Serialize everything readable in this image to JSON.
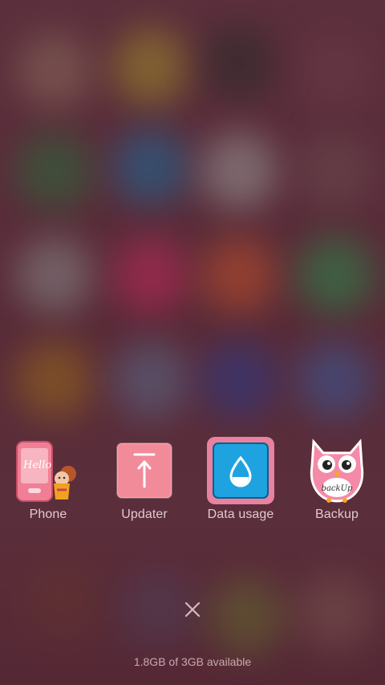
{
  "apps": [
    {
      "label": "Phone",
      "icon": "phone-hello-icon"
    },
    {
      "label": "Updater",
      "icon": "updater-icon"
    },
    {
      "label": "Data usage",
      "icon": "water-drop-icon"
    },
    {
      "label": "Backup",
      "icon": "owl-backup-icon"
    }
  ],
  "phone_icon_text": "Hello",
  "backup_icon_text": "backUp",
  "close_icon": "close-icon",
  "memory_text": "1.8GB of 3GB available",
  "colors": {
    "background": "#5a2d3a",
    "label": "#e3c9cf",
    "pink": "#f08a9b",
    "data_usage_blue": "#1ea3e0"
  }
}
